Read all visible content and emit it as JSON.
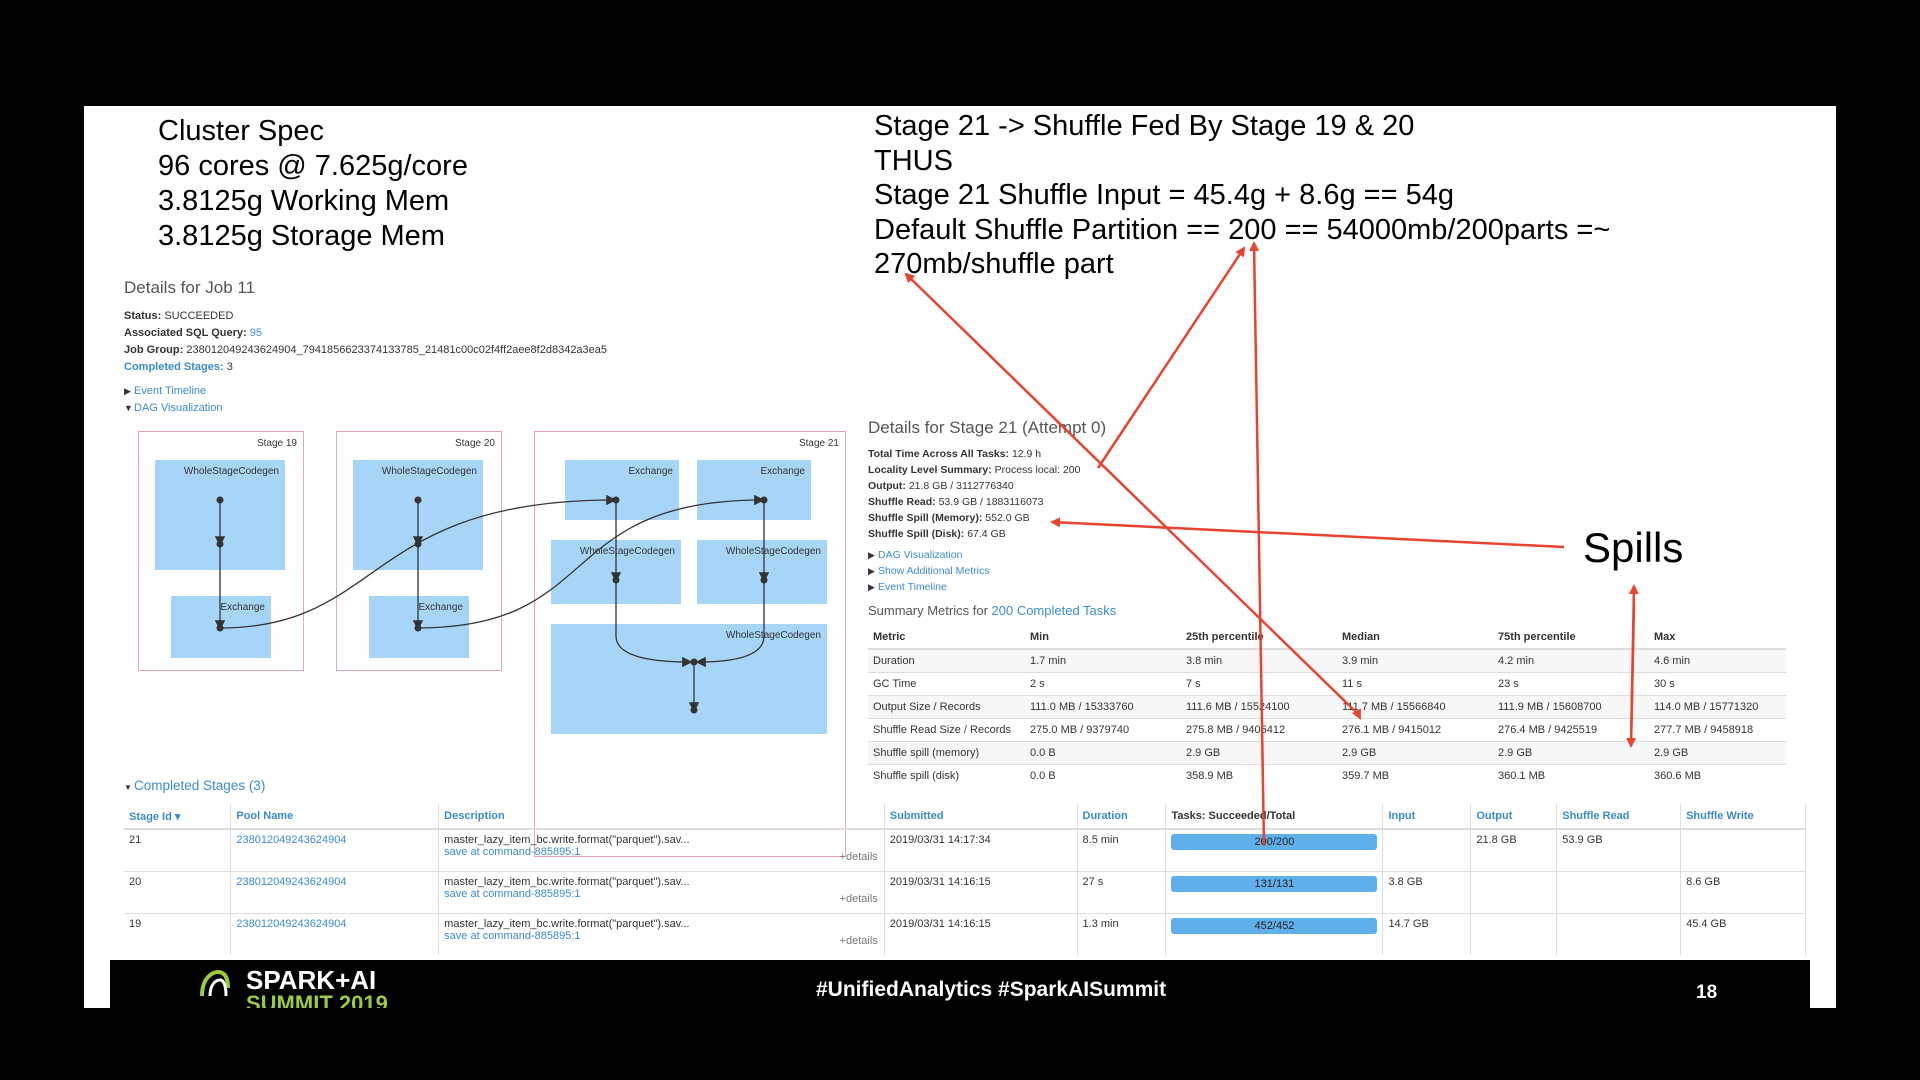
{
  "cluster_spec": [
    "Cluster Spec",
    "96 cores @ 7.625g/core",
    "3.8125g Working Mem",
    "3.8125g Storage Mem"
  ],
  "analysis": [
    "Stage 21 -> Shuffle Fed By Stage 19 & 20",
    "THUS",
    "Stage 21 Shuffle Input = 45.4g + 8.6g == 54g",
    "Default Shuffle Partition == 200 == 54000mb/200parts =~",
    "270mb/shuffle part"
  ],
  "spills_label": "Spills",
  "job": {
    "title": "Details for Job 11",
    "status_label": "Status:",
    "status": "SUCCEEDED",
    "sql_label": "Associated SQL Query:",
    "sql": "95",
    "group_label": "Job Group:",
    "group": "238012049243624904_7941856623374133785_21481c00c02f4ff2aee8f2d8342a3ea5",
    "stages_label": "Completed Stages:",
    "stages": "3",
    "event_timeline": "Event Timeline",
    "dag": "DAG Visualization"
  },
  "dag": {
    "stage19": {
      "label": "Stage 19",
      "wsc": "WholeStageCodegen",
      "exchange": "Exchange"
    },
    "stage20": {
      "label": "Stage 20",
      "wsc": "WholeStageCodegen",
      "exchange": "Exchange"
    },
    "stage21": {
      "label": "Stage 21",
      "ex1": "Exchange",
      "ex2": "Exchange",
      "wsc1": "WholeStageCodegen",
      "wsc2": "WholeStageCodegen",
      "wsc3": "WholeStageCodegen"
    }
  },
  "stage_details": {
    "title": "Details for Stage 21 (Attempt 0)",
    "rows": [
      {
        "k": "Total Time Across All Tasks:",
        "v": "12.9 h"
      },
      {
        "k": "Locality Level Summary:",
        "v": "Process local: 200"
      },
      {
        "k": "Output:",
        "v": "21.8 GB / 3112776340"
      },
      {
        "k": "Shuffle Read:",
        "v": "53.9 GB / 1883116073"
      },
      {
        "k": "Shuffle Spill (Memory):",
        "v": "552.0 GB"
      },
      {
        "k": "Shuffle Spill (Disk):",
        "v": "67.4 GB"
      }
    ],
    "links": [
      "DAG Visualization",
      "Show Additional Metrics",
      "Event Timeline"
    ],
    "summary_prefix": "Summary Metrics for ",
    "summary_link": "200 Completed Tasks"
  },
  "metrics": {
    "headers": [
      "Metric",
      "Min",
      "25th percentile",
      "Median",
      "75th percentile",
      "Max"
    ],
    "rows": [
      [
        "Duration",
        "1.7 min",
        "3.8 min",
        "3.9 min",
        "4.2 min",
        "4.6 min"
      ],
      [
        "GC Time",
        "2 s",
        "7 s",
        "11 s",
        "23 s",
        "30 s"
      ],
      [
        "Output Size / Records",
        "111.0 MB / 15333760",
        "111.6 MB / 15524100",
        "111.7 MB / 15566840",
        "111.9 MB / 15608700",
        "114.0 MB / 15771320"
      ],
      [
        "Shuffle Read Size / Records",
        "275.0 MB / 9379740",
        "275.8 MB / 9405412",
        "276.1 MB / 9415012",
        "276.4 MB / 9425519",
        "277.7 MB / 9458918"
      ],
      [
        "Shuffle spill (memory)",
        "0.0 B",
        "2.9 GB",
        "2.9 GB",
        "2.9 GB",
        "2.9 GB"
      ],
      [
        "Shuffle spill (disk)",
        "0.0 B",
        "358.9 MB",
        "359.7 MB",
        "360.1 MB",
        "360.6 MB"
      ]
    ]
  },
  "completed": {
    "title": "Completed Stages (3)",
    "headers": [
      "Stage Id ▾",
      "Pool Name",
      "Description",
      "Submitted",
      "Duration",
      "Tasks: Succeeded/Total",
      "Input",
      "Output",
      "Shuffle Read",
      "Shuffle Write"
    ],
    "rows": [
      {
        "id": "21",
        "pool": "238012049243624904",
        "desc": "master_lazy_item_bc.write.format(\"parquet\").sav...",
        "sub": "save at command-885895:1",
        "details": "+details",
        "submitted": "2019/03/31 14:17:34",
        "duration": "8.5 min",
        "tasks": "200/200",
        "progress": 1.0,
        "input": "",
        "output": "21.8 GB",
        "sread": "53.9 GB",
        "swrite": ""
      },
      {
        "id": "20",
        "pool": "238012049243624904",
        "desc": "master_lazy_item_bc.write.format(\"parquet\").sav...",
        "sub": "save at command-885895:1",
        "details": "+details",
        "submitted": "2019/03/31 14:16:15",
        "duration": "27 s",
        "tasks": "131/131",
        "progress": 1.0,
        "input": "3.8 GB",
        "output": "",
        "sread": "",
        "swrite": "8.6 GB"
      },
      {
        "id": "19",
        "pool": "238012049243624904",
        "desc": "master_lazy_item_bc.write.format(\"parquet\").sav...",
        "sub": "save at command-885895:1",
        "details": "+details",
        "submitted": "2019/03/31 14:16:15",
        "duration": "1.3 min",
        "tasks": "452/452",
        "progress": 1.0,
        "input": "14.7 GB",
        "output": "",
        "sread": "",
        "swrite": "45.4 GB"
      }
    ]
  },
  "footer": {
    "logo_text": "SPARK+AI",
    "logo_sub": "SUMMIT 2019",
    "hashtags": "#UnifiedAnalytics #SparkAISummit",
    "page": "18"
  },
  "colors": {
    "arrow": "#e8432e",
    "node": "#a6d5f7",
    "link": "#3b8bc9",
    "border": "#e9a4b4"
  }
}
